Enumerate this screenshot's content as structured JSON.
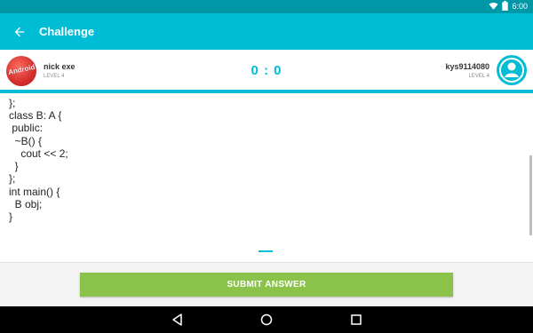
{
  "status": {
    "time": "6:00",
    "icons": [
      "wifi-icon",
      "battery-icon"
    ]
  },
  "appbar": {
    "title": "Challenge",
    "back_icon": "arrow-left-icon"
  },
  "match": {
    "player_left": {
      "name": "nick exe",
      "level": "LEVEL 4",
      "avatar": "android-logo-avatar"
    },
    "player_right": {
      "name": "kys9114080",
      "level": "LEVEL 4",
      "avatar": "user-avatar-icon"
    },
    "score": "0 : 0"
  },
  "code_lines": [
    "};",
    "class B: A {",
    " public:",
    "  ~B() {",
    "    cout << 2;",
    "  }",
    "};",
    "int main() {",
    "  B obj;",
    "}"
  ],
  "submit": {
    "label": "SUBMIT ANSWER"
  },
  "colors": {
    "accent": "#00bcd4",
    "status_bar": "#0097a7",
    "submit": "#8bc34a"
  },
  "navbar": {
    "icons": [
      "back-triangle-icon",
      "home-circle-icon",
      "recents-square-icon"
    ]
  }
}
